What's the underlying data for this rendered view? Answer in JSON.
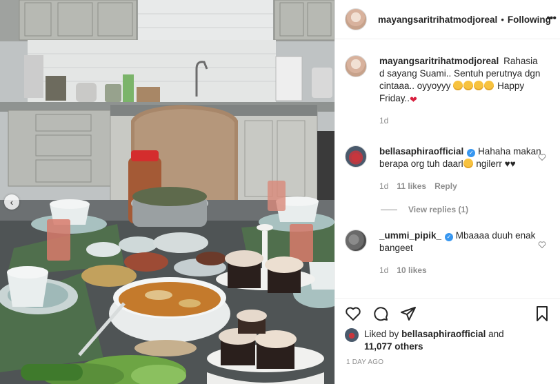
{
  "post": {
    "author": "mayangsaritrihatmodjoreal",
    "separator": "•",
    "follow_status": "Following",
    "more_label": "•••"
  },
  "caption": {
    "author": "mayangsaritrihatmodjoreal",
    "text": "Rahasia d sayang Suami.. Sentuh perutnya dgn cintaaa.. oyyoyyy",
    "text_after_emoji": "Happy Friday..",
    "time": "1d"
  },
  "comments": [
    {
      "author": "bellasaphiraofficial",
      "verified": true,
      "text": "Hahaha makan berapa org tuh daarl",
      "text_after_emoji": "ngilerr ♥♥",
      "time": "1d",
      "likes": "11 likes",
      "reply_label": "Reply"
    },
    {
      "author": "_ummi_pipik_",
      "verified": true,
      "text": "Mbaaaa duuh enak bangeet",
      "time": "1d",
      "likes": "10 likes"
    }
  ],
  "view_replies": "View replies (1)",
  "likes_line": {
    "prefix": "Liked by",
    "user": "bellasaphiraofficial",
    "conjunction": "and",
    "others": "11,077 others"
  },
  "posted_ago": "1 DAY AGO",
  "icons": {
    "prev": "chevron-left-icon",
    "like": "heart-icon",
    "comment": "comment-bubble-icon",
    "share": "paper-plane-icon",
    "save": "bookmark-icon"
  },
  "colors": {
    "text": "#262626",
    "muted": "#8e8e8e",
    "verified": "#3897f0",
    "border": "#efefef"
  }
}
